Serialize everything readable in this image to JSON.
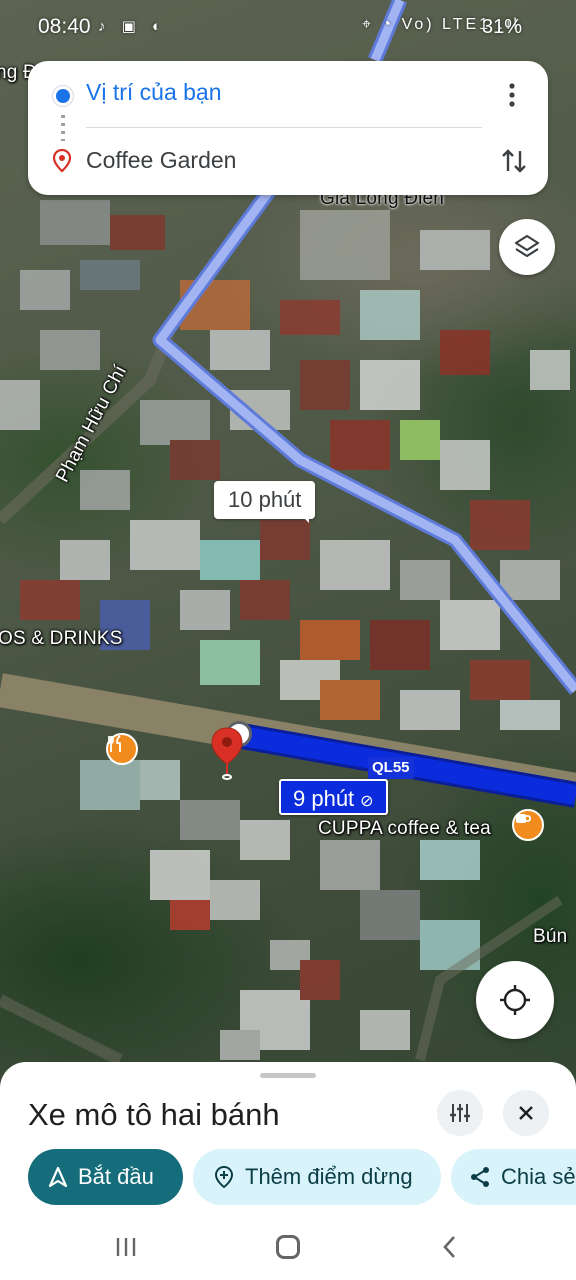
{
  "status_bar": {
    "time": "08:40",
    "left_icons": "♪ ▣ ◐",
    "right_icons": "⌖ ◔ Vo) LTE1 .ıl",
    "battery": "31%"
  },
  "directions": {
    "origin": "Vị trí của bạn",
    "destination": "Coffee Garden"
  },
  "map": {
    "labels": {
      "top_left": "ng Đ",
      "gia_long_dien": "Gia Long Điền",
      "pham_huu_chi": "Phạm Hữu Chí",
      "foods_drinks": "OS & DRINKS",
      "cuppa": "CUPPA coffee & tea",
      "bun": "Bún"
    },
    "route_shield": "QL55",
    "alt_route_time": "10 phút",
    "main_route_time": "9 phút"
  },
  "sheet": {
    "mode_title": "Xe mô tô hai bánh",
    "start_label": "Bắt đầu",
    "add_stop_label": "Thêm điểm dừng",
    "share_label": "Chia sẻ"
  },
  "colors": {
    "route_main": "#0b2cdc",
    "route_alt": "#8fa2f0",
    "primary_button": "#156c7a",
    "tonal_button": "#d9f3fa",
    "origin_dot": "#1a73e8",
    "pin_red": "#d93025"
  }
}
